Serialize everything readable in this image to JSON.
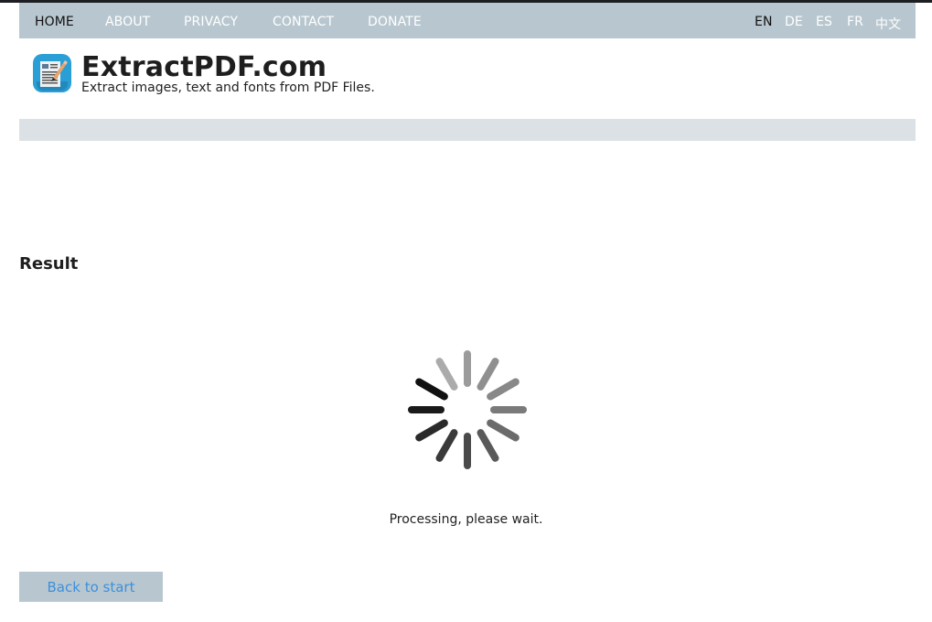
{
  "nav": {
    "items": [
      {
        "label": "HOME",
        "active": true
      },
      {
        "label": "ABOUT",
        "active": false
      },
      {
        "label": "PRIVACY",
        "active": false
      },
      {
        "label": "CONTACT",
        "active": false
      },
      {
        "label": "DONATE",
        "active": false
      }
    ],
    "languages": [
      {
        "label": "EN",
        "active": true
      },
      {
        "label": "DE",
        "active": false
      },
      {
        "label": "ES",
        "active": false
      },
      {
        "label": "FR",
        "active": false
      },
      {
        "label": "中文",
        "active": false
      }
    ]
  },
  "header": {
    "logo_icon": "pdf-document-pen-icon",
    "title": "ExtractPDF.com",
    "subtitle": "Extract images, text and fonts from PDF Files."
  },
  "main": {
    "heading": "Result",
    "spinner_icon": "loading-spinner-icon",
    "status_text": "Processing, please wait.",
    "back_button_label": "Back to start"
  },
  "colors": {
    "nav_bg": "#b8c7cf",
    "band_bg": "#dbe1e4",
    "link_blue": "#3d8fdb",
    "logo_blue": "#2a9fd6"
  }
}
